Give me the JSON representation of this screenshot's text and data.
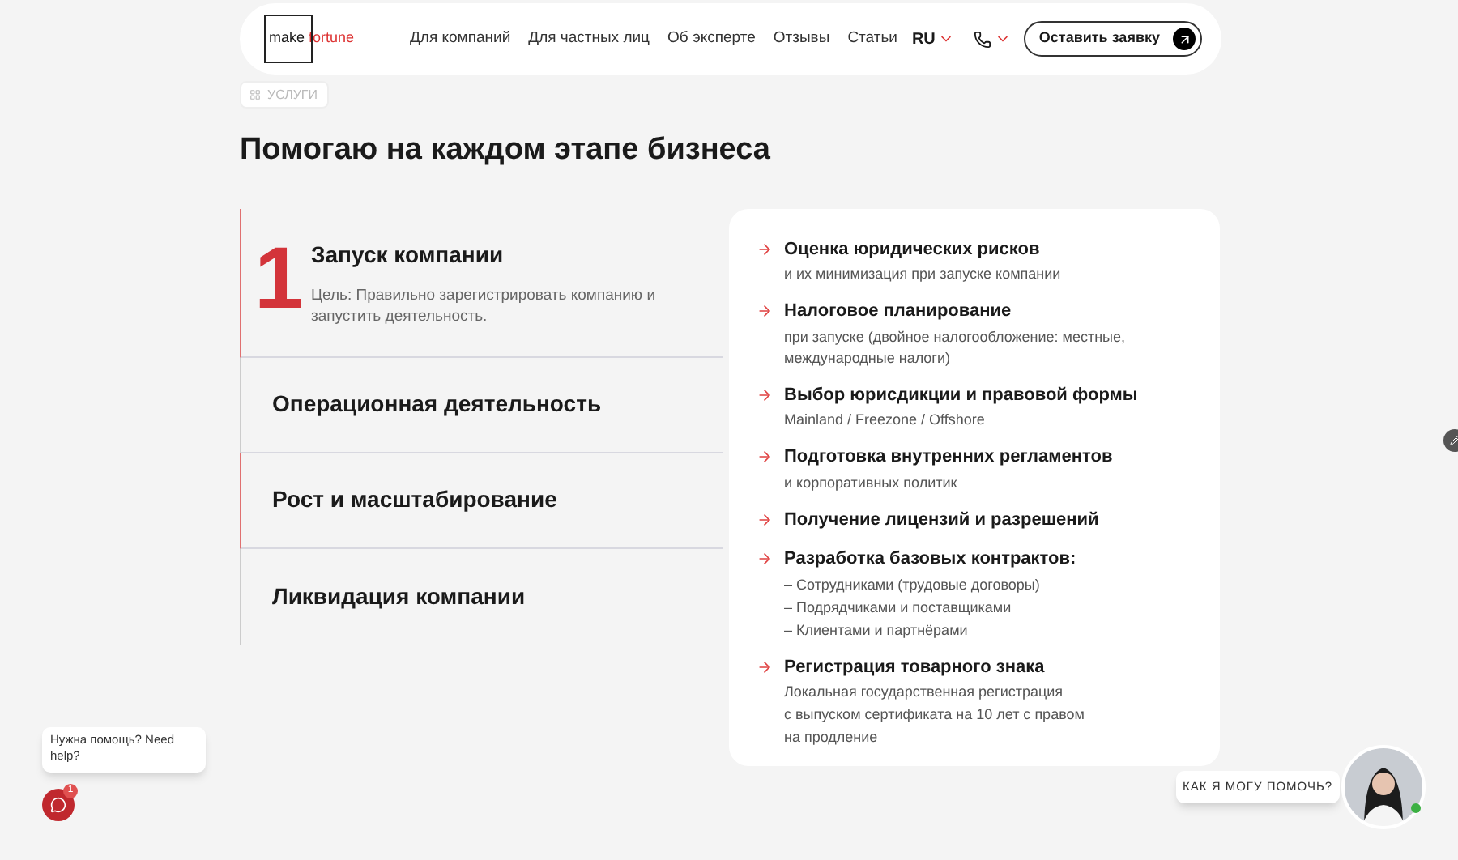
{
  "header": {
    "logo": {
      "first": "make",
      "second": "fortune"
    },
    "nav": [
      "Для компаний",
      "Для частных лиц",
      "Об эксперте",
      "Отзывы",
      "Статьи"
    ],
    "language": "RU",
    "cta": "Оставить заявку"
  },
  "tag": "УСЛУГИ",
  "title": "Помогаю на каждом этапе бизнеса",
  "steps": [
    {
      "number": "1",
      "title": "Запуск компании",
      "description": "Цель: Правильно зарегистрировать компанию и запустить деятельность.",
      "expanded": true,
      "accent": true
    },
    {
      "title": "Операционная деятельность",
      "expanded": false,
      "accent": false
    },
    {
      "title": "Рост и масштабирование",
      "expanded": false,
      "accent": true
    },
    {
      "title": "Ликвидация компании",
      "expanded": false,
      "accent": false
    }
  ],
  "services": [
    {
      "title": "Оценка юридических рисков",
      "lines": [
        "и их минимизация при запуске компании"
      ]
    },
    {
      "title": "Налоговое планирование",
      "lines": [
        "при запуске (двойное налогообложение: местные, международные налоги)"
      ]
    },
    {
      "title": "Выбор юрисдикции и правовой формы",
      "lines": [
        "Mainland / Freezone / Offshore"
      ]
    },
    {
      "title": "Подготовка внутренних регламентов",
      "lines": [
        "и корпоративных политик"
      ]
    },
    {
      "title": "Получение лицензий и разрешений"
    },
    {
      "title": "Разработка базовых контрактов:",
      "lines": [
        "– Сотрудниками (трудовые договоры)",
        "– Подрядчиками и поставщиками",
        "– Клиентами и партнёрами"
      ]
    },
    {
      "title": "Регистрация товарного знака",
      "lines": [
        "Локальная государственная регистрация",
        "с выпуском сертификата на 10 лет с правом",
        "на продление"
      ]
    }
  ],
  "help_widget": {
    "message": "Нужна помощь? Need help?",
    "badge": "1"
  },
  "assistant": {
    "message": "КАК Я МОГУ ПОМОЧЬ?",
    "online": true
  }
}
